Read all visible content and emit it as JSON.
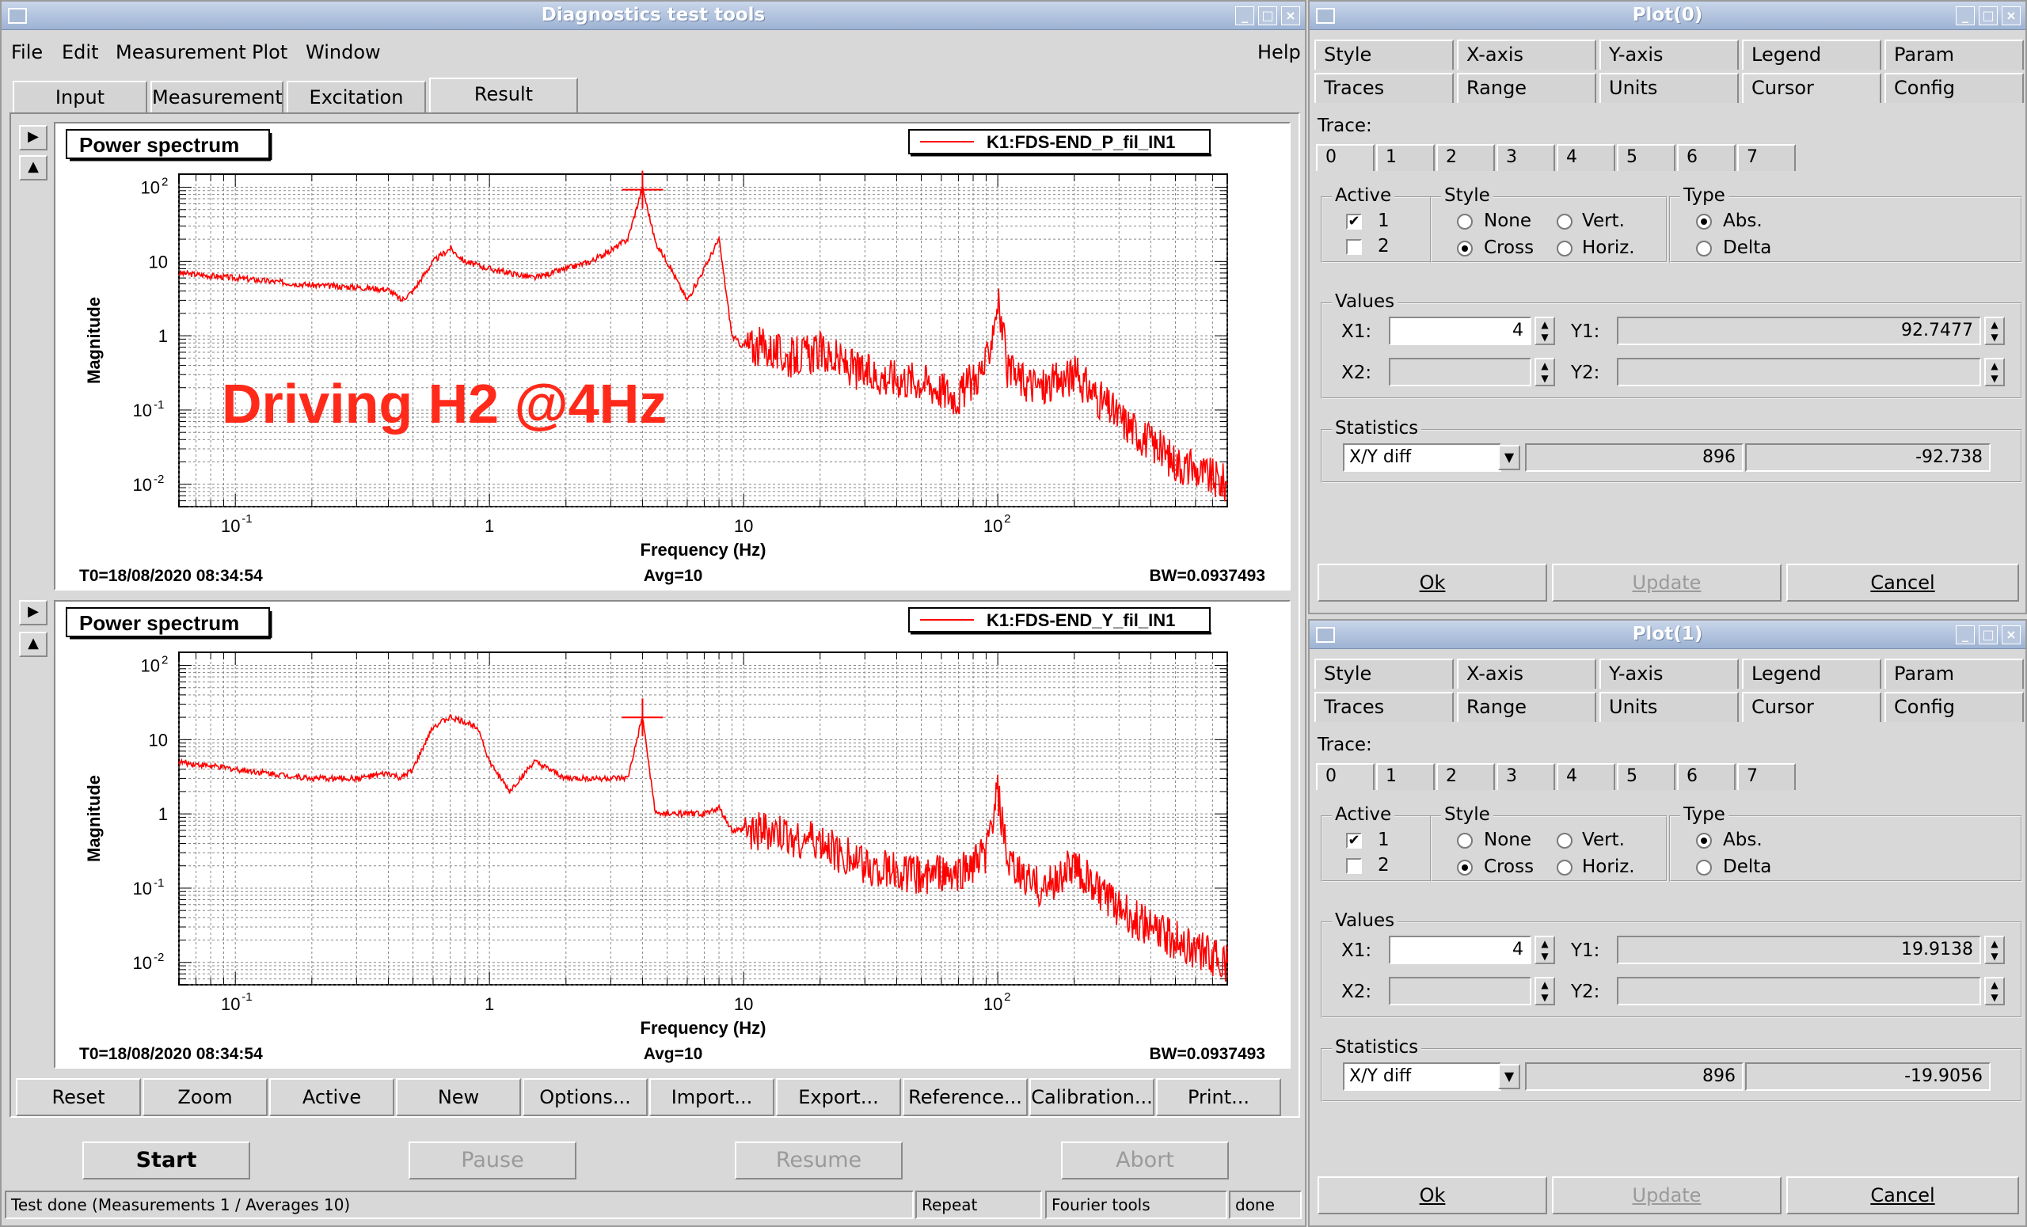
{
  "main": {
    "title": "Diagnostics test tools",
    "menus": [
      "File",
      "Edit",
      "Measurement",
      "Plot",
      "Window"
    ],
    "help": "Help",
    "tabs": [
      "Input",
      "Measurement",
      "Excitation",
      "Result"
    ],
    "overlay": "Driving H2 @4Hz",
    "plot_label": "Power spectrum",
    "ylabel": "Magnitude",
    "xlabel": "Frequency (Hz)",
    "yticks": [
      "10",
      "10",
      "10",
      "1",
      "10",
      "10"
    ],
    "ytick_exps": [
      "2",
      "",
      "",
      "",
      "-1",
      "-2"
    ],
    "xticks": [
      "10",
      "1",
      "10",
      "10"
    ],
    "xtick_exps": [
      "-1",
      "",
      "",
      "2"
    ],
    "plots": [
      {
        "legend": "K1:FDS-END_P_fil_IN1",
        "t0": "T0=18/08/2020 08:34:54",
        "avg": "Avg=10",
        "bw": "BW=0.0937493"
      },
      {
        "legend": "K1:FDS-END_Y_fil_IN1",
        "t0": "T0=18/08/2020 08:34:54",
        "avg": "Avg=10",
        "bw": "BW=0.0937493"
      }
    ],
    "toolbar": [
      "Reset",
      "Zoom",
      "Active",
      "New",
      "Options...",
      "Import...",
      "Export...",
      "Reference...",
      "Calibration...",
      "Print..."
    ],
    "run": {
      "start": "Start",
      "pause": "Pause",
      "resume": "Resume",
      "abort": "Abort"
    },
    "status": {
      "msg": "Test done (Measurements 1 / Averages 10)",
      "repeat": "Repeat",
      "fourier": "Fourier tools",
      "done": "done"
    }
  },
  "chart_data": [
    {
      "type": "line",
      "title": "Power spectrum",
      "xlabel": "Frequency (Hz)",
      "ylabel": "Magnitude",
      "xscale": "log",
      "yscale": "log",
      "xlim": [
        0.06,
        800
      ],
      "ylim": [
        0.005,
        150
      ],
      "series": [
        {
          "name": "K1:FDS-END_P_fil_IN1",
          "color": "#ff0000",
          "x": [
            0.06,
            0.1,
            0.2,
            0.3,
            0.4,
            0.45,
            0.5,
            0.6,
            0.7,
            0.8,
            1,
            1.5,
            2,
            2.5,
            3,
            3.5,
            4,
            4.5,
            5,
            6,
            7,
            8,
            9,
            10,
            12,
            15,
            20,
            30,
            50,
            70,
            90,
            100,
            110,
            150,
            200,
            300,
            500,
            800
          ],
          "y": [
            7,
            6,
            4.8,
            4.5,
            4.2,
            3,
            4,
            10,
            15,
            10,
            8,
            6,
            8,
            10,
            14,
            20,
            100,
            18,
            10,
            3,
            8,
            20,
            1,
            0.7,
            0.7,
            0.5,
            0.6,
            0.3,
            0.25,
            0.15,
            0.4,
            3,
            0.3,
            0.2,
            0.3,
            0.08,
            0.02,
            0.01
          ]
        }
      ],
      "cursor": {
        "x": 4,
        "y": 92.7477
      }
    },
    {
      "type": "line",
      "title": "Power spectrum",
      "xlabel": "Frequency (Hz)",
      "ylabel": "Magnitude",
      "xscale": "log",
      "yscale": "log",
      "xlim": [
        0.06,
        800
      ],
      "ylim": [
        0.005,
        150
      ],
      "series": [
        {
          "name": "K1:FDS-END_Y_fil_IN1",
          "color": "#ff0000",
          "x": [
            0.06,
            0.1,
            0.2,
            0.3,
            0.4,
            0.45,
            0.5,
            0.6,
            0.7,
            0.9,
            1,
            1.2,
            1.5,
            2,
            2.5,
            3,
            3.5,
            4,
            4.5,
            5,
            7,
            8,
            9,
            10,
            15,
            20,
            30,
            50,
            70,
            90,
            100,
            110,
            150,
            200,
            300,
            500,
            800
          ],
          "y": [
            5,
            4,
            3,
            3,
            3.5,
            3,
            4,
            15,
            20,
            15,
            5,
            2,
            5,
            3,
            3,
            3,
            3,
            20,
            1,
            1,
            1,
            1.2,
            0.6,
            0.6,
            0.5,
            0.4,
            0.2,
            0.15,
            0.15,
            0.3,
            2,
            0.2,
            0.1,
            0.2,
            0.05,
            0.02,
            0.01
          ]
        }
      ],
      "cursor": {
        "x": 4,
        "y": 19.9138
      }
    }
  ],
  "panels": [
    {
      "title": "Plot(0)",
      "y1": "92.7477",
      "stat_x": "896",
      "stat_y": "-92.738"
    },
    {
      "title": "Plot(1)",
      "y1": "19.9138",
      "stat_x": "896",
      "stat_y": "-19.9056"
    }
  ],
  "panel_common": {
    "tabs_row1": [
      "Style",
      "X-axis",
      "Y-axis",
      "Legend",
      "Param"
    ],
    "tabs_row2": [
      "Traces",
      "Range",
      "Units",
      "Cursor",
      "Config"
    ],
    "trace_label": "Trace:",
    "traces": [
      "0",
      "1",
      "2",
      "3",
      "4",
      "5",
      "6",
      "7"
    ],
    "active_label": "Active",
    "active_1": "1",
    "active_2": "2",
    "style_label": "Style",
    "none": "None",
    "vert": "Vert.",
    "cross": "Cross",
    "horiz": "Horiz.",
    "type_label": "Type",
    "abs": "Abs.",
    "delta": "Delta",
    "values_label": "Values",
    "x1": "X1:",
    "x2": "X2:",
    "y1": "Y1:",
    "y2": "Y2:",
    "x1_value": "4",
    "stats_label": "Statistics",
    "stats_select": "X/Y diff",
    "ok": "Ok",
    "update": "Update",
    "cancel": "Cancel"
  }
}
